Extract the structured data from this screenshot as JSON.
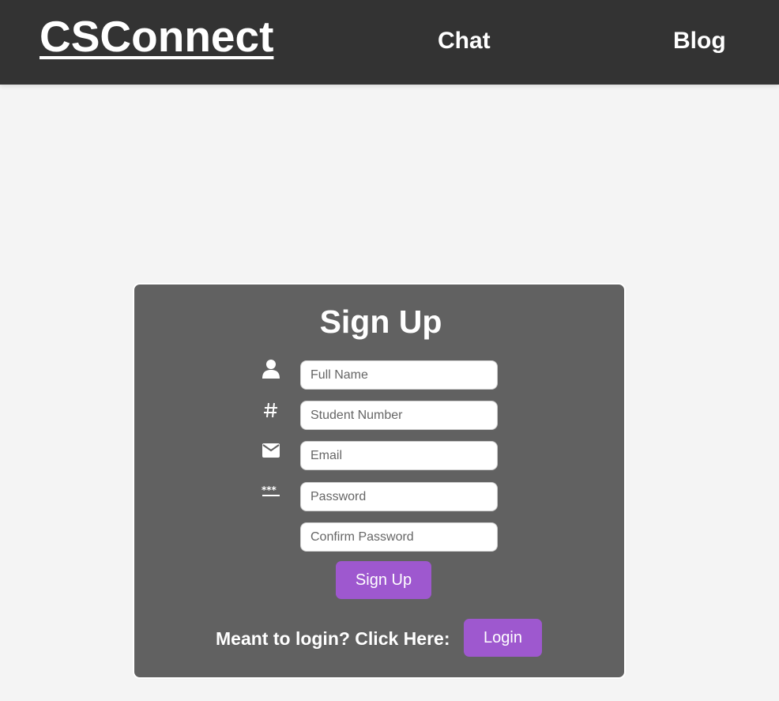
{
  "navbar": {
    "brand": "CSConnect",
    "links": [
      {
        "label": "Chat"
      },
      {
        "label": "Blog"
      }
    ]
  },
  "signup": {
    "title": "Sign Up",
    "fields": {
      "full_name": {
        "placeholder": "Full Name",
        "icon": "user-icon"
      },
      "student_number": {
        "placeholder": "Student Number",
        "icon": "hash-icon"
      },
      "email": {
        "placeholder": "Email",
        "icon": "envelope-icon"
      },
      "password": {
        "placeholder": "Password",
        "icon": "password-icon"
      },
      "confirm_password": {
        "placeholder": "Confirm Password"
      }
    },
    "submit_label": "Sign Up",
    "login_prompt": "Meant to login? Click Here:",
    "login_label": "Login"
  },
  "colors": {
    "navbar_bg": "#333333",
    "page_bg": "#f4f4f4",
    "card_bg": "#616161",
    "accent": "#9e58cf"
  }
}
